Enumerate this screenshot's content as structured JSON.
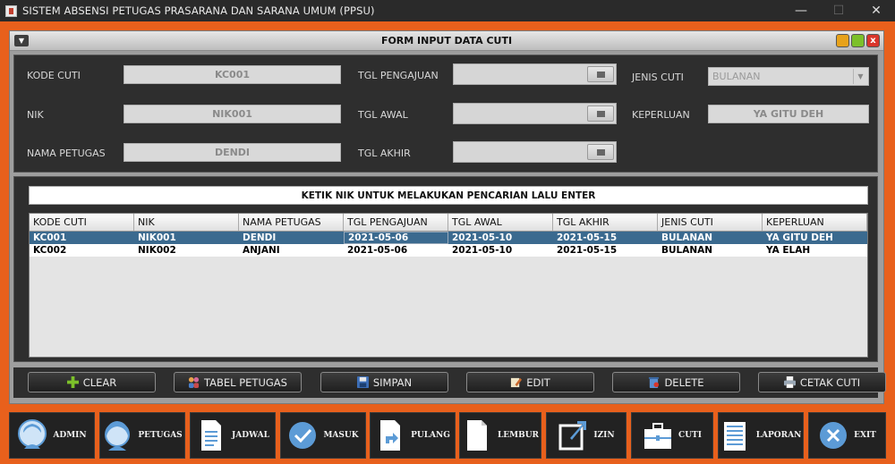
{
  "window": {
    "title": "SISTEM ABSENSI PETUGAS PRASARANA DAN SARANA UMUM (PPSU)",
    "min": "—",
    "max": "☐",
    "close": "✕"
  },
  "frame": {
    "title": "FORM INPUT DATA CUTI"
  },
  "form": {
    "kode_cuti_label": "KODE CUTI",
    "kode_cuti_value": "KC001",
    "nik_label": "NIK",
    "nik_value": "NIK001",
    "nama_label": "NAMA PETUGAS",
    "nama_value": "DENDI",
    "tgl_pengajuan_label": "TGL PENGAJUAN",
    "tgl_awal_label": "TGL AWAL",
    "tgl_akhir_label": "TGL AKHIR",
    "jenis_label": "JENIS CUTI",
    "jenis_value": "BULANAN",
    "keperluan_label": "KEPERLUAN",
    "keperluan_value": "YA GITU DEH"
  },
  "search": {
    "text": "KETIK NIK UNTUK MELAKUKAN PENCARIAN LALU ENTER"
  },
  "table": {
    "headers": [
      "KODE CUTI",
      "NIK",
      "NAMA PETUGAS",
      "TGL PENGAJUAN",
      "TGL AWAL",
      "TGL AKHIR",
      "JENIS CUTI",
      "KEPERLUAN"
    ],
    "rows": [
      [
        "KC001",
        "NIK001",
        "DENDI",
        "2021-05-06",
        "2021-05-10",
        "2021-05-15",
        "BULANAN",
        "YA GITU DEH"
      ],
      [
        "KC002",
        "NIK002",
        "ANJANI",
        "2021-05-06",
        "2021-05-10",
        "2021-05-15",
        "BULANAN",
        "YA ELAH"
      ]
    ]
  },
  "actions": {
    "clear": "CLEAR",
    "tabel_petugas": "TABEL PETUGAS",
    "simpan": "SIMPAN",
    "edit": "EDIT",
    "delete": "DELETE",
    "cetak": "CETAK CUTI"
  },
  "nav": {
    "admin": "ADMIN",
    "petugas": "PETUGAS",
    "jadwal": "JADWAL",
    "masuk": "MASUK",
    "pulang": "PULANG",
    "lembur": "LEMBUR",
    "izin": "IZIN",
    "cuti": "CUTI",
    "laporan": "LAPORAN",
    "exit": "EXIT"
  },
  "colors": {
    "accent": "#e8601c",
    "selected_row": "#3b6a8f",
    "dark_bg": "#2e2e2e"
  }
}
